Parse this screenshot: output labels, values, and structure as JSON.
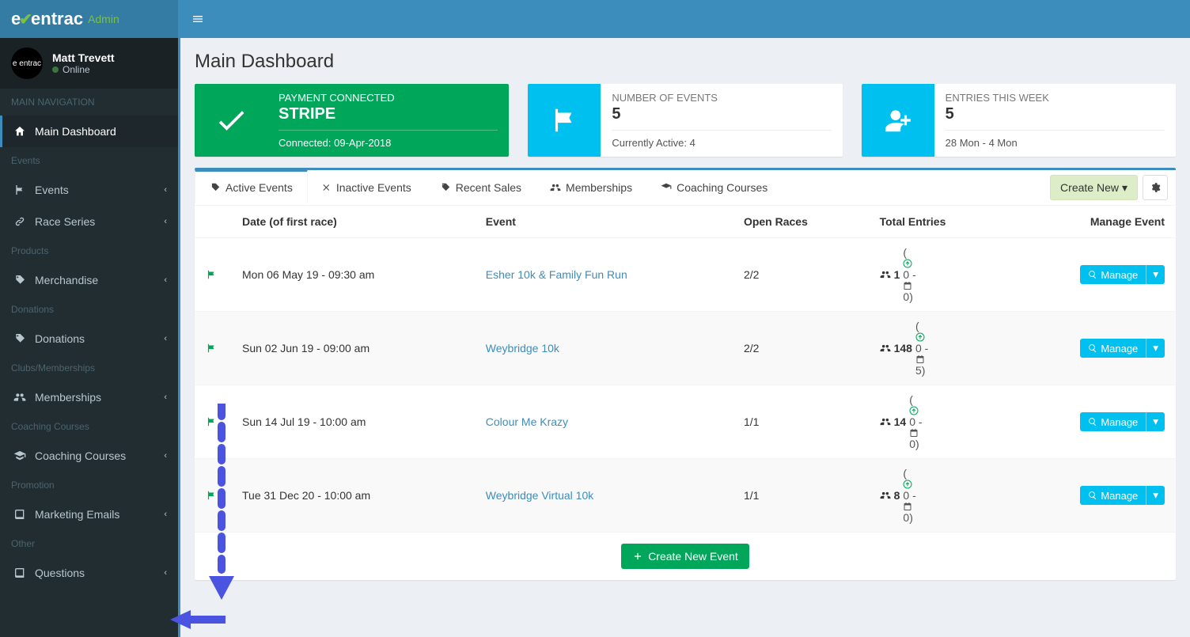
{
  "logo": {
    "brand_e": "e",
    "brand_entrac": "entrac",
    "admin": "Admin"
  },
  "user": {
    "name": "Matt Trevett",
    "status": "Online",
    "avatar_text": "e entrac"
  },
  "nav": {
    "section_main": "MAIN NAVIGATION",
    "dashboard": "Main Dashboard",
    "section_events": "Events",
    "events": "Events",
    "race_series": "Race Series",
    "section_products": "Products",
    "merchandise": "Merchandise",
    "section_donations": "Donations",
    "donations": "Donations",
    "section_clubs": "Clubs/Memberships",
    "memberships": "Memberships",
    "section_coaching": "Coaching Courses",
    "coaching": "Coaching Courses",
    "section_promotion": "Promotion",
    "marketing": "Marketing Emails",
    "section_other": "Other",
    "questions": "Questions"
  },
  "page": {
    "title": "Main Dashboard"
  },
  "cards": {
    "payment": {
      "label": "PAYMENT CONNECTED",
      "value": "STRIPE",
      "sub": "Connected: 09-Apr-2018"
    },
    "events": {
      "label": "NUMBER OF EVENTS",
      "value": "5",
      "sub": "Currently Active: 4"
    },
    "entries": {
      "label": "ENTRIES THIS WEEK",
      "value": "5",
      "sub": "28 Mon - 4 Mon"
    }
  },
  "tabs": {
    "active": "Active Events",
    "inactive": "Inactive Events",
    "recent_sales": "Recent Sales",
    "memberships": "Memberships",
    "coaching": "Coaching Courses",
    "create_new": "Create New"
  },
  "table": {
    "headers": {
      "date": "Date (of first race)",
      "event": "Event",
      "open": "Open Races",
      "total": "Total Entries",
      "manage": "Manage Event"
    },
    "rows": [
      {
        "date": "Mon 06 May 19 - 09:30 am",
        "event": "Esher 10k & Family Fun Run",
        "open": "2/2",
        "total": "1",
        "upload": "0",
        "calendar": "0"
      },
      {
        "date": "Sun 02 Jun 19 - 09:00 am",
        "event": "Weybridge 10k",
        "open": "2/2",
        "total": "148",
        "upload": "0",
        "calendar": "5"
      },
      {
        "date": "Sun 14 Jul 19 - 10:00 am",
        "event": "Colour Me Krazy",
        "open": "1/1",
        "total": "14",
        "upload": "0",
        "calendar": "0"
      },
      {
        "date": "Tue 31 Dec 20 - 10:00 am",
        "event": "Weybridge Virtual 10k",
        "open": "1/1",
        "total": "8",
        "upload": "0",
        "calendar": "0"
      }
    ],
    "manage_label": "Manage",
    "create_event": "Create New Event"
  }
}
